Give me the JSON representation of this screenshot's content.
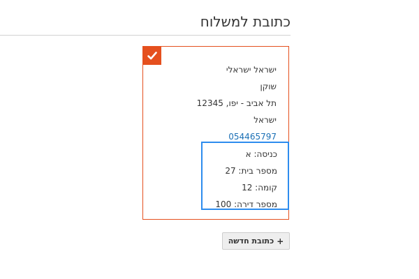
{
  "page": {
    "title": "כתובת למשלוח"
  },
  "colors": {
    "accent": "#e5501e",
    "highlight": "#2d8cee",
    "link": "#1a6fb5"
  },
  "address_card": {
    "selected": true,
    "check_icon": "checkmark-icon",
    "name": "ישראל ישראלי",
    "street": "שוקן",
    "city_zip": "תל אביב - יפו, 12345",
    "country": "ישראל",
    "phone": "054465797",
    "extra": {
      "entrance": "כניסה: א",
      "house_number": "מספר בית: 27",
      "floor": "קומה: 12",
      "apartment": "מספר דירה: 100"
    }
  },
  "new_address_button": {
    "icon": "plus-icon",
    "icon_glyph": "+",
    "label": "כתובת חדשה"
  }
}
